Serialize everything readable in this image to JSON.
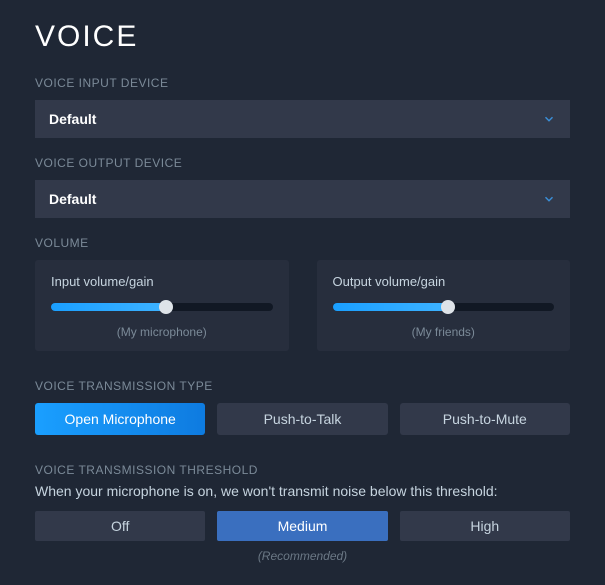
{
  "title": "VOICE",
  "input_device": {
    "label": "VOICE INPUT DEVICE",
    "value": "Default"
  },
  "output_device": {
    "label": "VOICE OUTPUT DEVICE",
    "value": "Default"
  },
  "volume": {
    "label": "VOLUME",
    "input": {
      "title": "Input volume/gain",
      "sub": "(My microphone)",
      "percent": 52
    },
    "output": {
      "title": "Output volume/gain",
      "sub": "(My friends)",
      "percent": 52
    }
  },
  "transmission_type": {
    "label": "VOICE TRANSMISSION TYPE",
    "options": [
      "Open Microphone",
      "Push-to-Talk",
      "Push-to-Mute"
    ],
    "active": 0
  },
  "threshold": {
    "label": "VOICE TRANSMISSION THRESHOLD",
    "desc": "When your microphone is on, we won't transmit noise below this threshold:",
    "options": [
      "Off",
      "Medium",
      "High"
    ],
    "active": 1,
    "recommended": "(Recommended)"
  }
}
